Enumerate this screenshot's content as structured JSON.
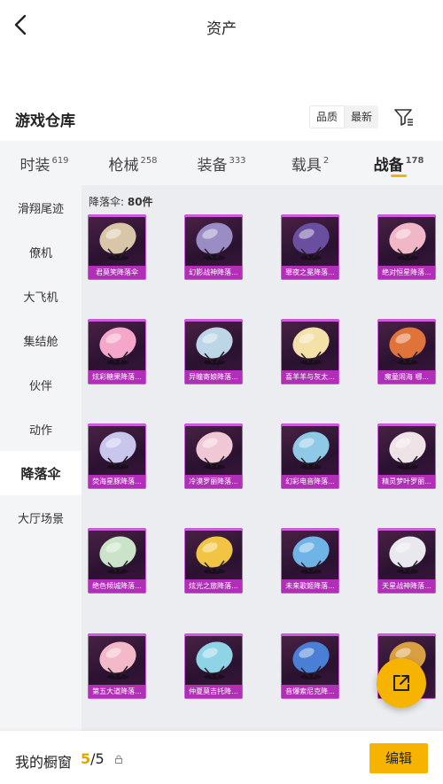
{
  "header": {
    "title": "资产",
    "back_icon": "chevron-left-icon"
  },
  "warehouse": {
    "title": "游戏仓库",
    "sort_options": [
      "品质",
      "最新"
    ],
    "sort_active": "品质",
    "filter_icon": "filter-icon"
  },
  "category_tabs": [
    {
      "label": "时装",
      "count": "619",
      "active": false
    },
    {
      "label": "枪械",
      "count": "258",
      "active": false
    },
    {
      "label": "装备",
      "count": "333",
      "active": false
    },
    {
      "label": "载具",
      "count": "2",
      "active": false
    },
    {
      "label": "战备",
      "count": "178",
      "active": true
    }
  ],
  "side_nav": [
    {
      "label": "滑翔尾迹",
      "active": false
    },
    {
      "label": "僚机",
      "active": false
    },
    {
      "label": "大飞机",
      "active": false
    },
    {
      "label": "集结舱",
      "active": false
    },
    {
      "label": "伙伴",
      "active": false
    },
    {
      "label": "动作",
      "active": false
    },
    {
      "label": "降落伞",
      "active": true
    },
    {
      "label": "大厅场景",
      "active": false
    }
  ],
  "content": {
    "section_label": "降落伞: ",
    "section_count": "80件"
  },
  "items": [
    {
      "name": "君莫笑降落伞",
      "color": "#d9c6a8"
    },
    {
      "name": "幻影战神降落...",
      "color": "#9a8cc4"
    },
    {
      "name": "罪夜之冕降落...",
      "color": "#6a4fa0"
    },
    {
      "name": "绝对恒星降落...",
      "color": "#f0b7c6"
    },
    {
      "name": "炫彩糖果降落...",
      "color": "#f4a7c8"
    },
    {
      "name": "异瞳寄娘降落...",
      "color": "#bcd6e8"
    },
    {
      "name": "喜羊羊与灰太...",
      "color": "#f3e1a8"
    },
    {
      "name": "魔童闹海 哪...",
      "color": "#e0733a"
    },
    {
      "name": "荧海星豚降落...",
      "color": "#c9c6ee"
    },
    {
      "name": "冷漠罗丽降落...",
      "color": "#f0c7d4"
    },
    {
      "name": "幻彩电音降落...",
      "color": "#8ec9e6"
    },
    {
      "name": "精灵梦叶罗丽...",
      "color": "#efe3e8"
    },
    {
      "name": "绝色倾城降落...",
      "color": "#cbe4c9"
    },
    {
      "name": "炫光之旅降落...",
      "color": "#f2c443"
    },
    {
      "name": "未来歌姬降落...",
      "color": "#6fb4e6"
    },
    {
      "name": "天星战神降落...",
      "color": "#e8e8ee"
    },
    {
      "name": "第五大道降落...",
      "color": "#f3b9c8"
    },
    {
      "name": "仲夏莫吉托降...",
      "color": "#8fd3e6"
    },
    {
      "name": "音爆索尼克降...",
      "color": "#4a7fd6"
    },
    {
      "name": "",
      "color": "#d9a042"
    }
  ],
  "fab": {
    "icon": "share-icon"
  },
  "bottom": {
    "showcase_label": "我的橱窗",
    "showcase_current": "5",
    "showcase_total": "/5",
    "lock_icon": "lock-icon",
    "edit_label": "编辑"
  }
}
